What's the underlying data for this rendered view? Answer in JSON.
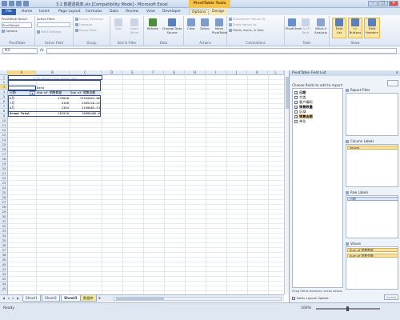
{
  "app": {
    "window_title": "3.1 数据透视表.xls [Compatibility Mode] - Microsoft Excel",
    "context_tab_group": "PivotTable Tools",
    "win_controls": [
      "–",
      "□",
      "✕"
    ]
  },
  "tabs": [
    {
      "label": "File"
    },
    {
      "label": "Home"
    },
    {
      "label": "Insert"
    },
    {
      "label": "Page Layout"
    },
    {
      "label": "Formulas"
    },
    {
      "label": "Data"
    },
    {
      "label": "Review"
    },
    {
      "label": "View"
    },
    {
      "label": "Developer"
    },
    {
      "label": "Options"
    },
    {
      "label": "Design"
    }
  ],
  "ribbon": {
    "pivot_name_label": "PivotTable Name:",
    "pivot_name_value": "PivotTable9",
    "options_label": "Options",
    "active_field_label": "Active Field:",
    "field_settings": "Field Settings",
    "group_selection": "Group Selection",
    "ungroup": "Ungroup",
    "group_field": "Group Field",
    "sort": "Sort",
    "insert_slicer": "Insert Slicer",
    "refresh": "Refresh",
    "change_data_source": "Change Data Source",
    "clear": "Clear",
    "select": "Select",
    "move_pivottable": "Move PivotTable",
    "summarize_values_by": "Summarize Values By",
    "show_values_as": "Show Values As",
    "fields_items_sets": "Fields, Items, & Sets",
    "pivotchart": "PivotChart",
    "olap_tools": "OLAP Tools",
    "what_if": "What-If Analysis",
    "field_list": "Field List",
    "buttons": "+/- Buttons",
    "field_headers": "Field Headers",
    "groups": {
      "pivottable": "PivotTable",
      "active_field": "Active Field",
      "group": "Group",
      "sort_filter": "Sort & Filter",
      "data": "Data",
      "actions": "Actions",
      "calculations": "Calculations",
      "tools": "Tools",
      "show": "Show"
    }
  },
  "formula_bar": {
    "name_box": "A3",
    "fx": "fx",
    "content": ""
  },
  "sheet": {
    "columns": [
      "A",
      "B",
      "C",
      "D",
      "E",
      "F",
      "G",
      "H",
      "I",
      "J",
      "K",
      "L"
    ],
    "rows": [
      "1",
      "2",
      "3",
      "4",
      "5",
      "6",
      "7",
      "8",
      "9",
      "10",
      "11",
      "12",
      "13",
      "14",
      "15",
      "16",
      "17",
      "18",
      "19",
      "20",
      "21",
      "22",
      "23",
      "24",
      "25",
      "26",
      "27",
      "28",
      "29",
      "30",
      "31",
      "32",
      "33",
      "34",
      "35",
      "36",
      "37",
      "38",
      "39",
      "40",
      "41",
      "42",
      "43",
      "44",
      "45"
    ],
    "report_filter_hint": "Drop Report Filter Fields Here",
    "data_label": "Data",
    "row_label_header": "日期",
    "col1_header": "Sum of 销售数量",
    "col2_header": "Sum of 销售金额",
    "pivot_rows": [
      {
        "label": "6月",
        "qty": "175048",
        "amount": "72342053.88"
      },
      {
        "label": "7月",
        "qty": "4168",
        "amount": "2365118.22"
      },
      {
        "label": "8月",
        "qty": "2304",
        "amount": "2190885.53"
      }
    ],
    "grand_total_label": "Grand Total",
    "grand_total_qty": "181518",
    "grand_total_amount": "76898406.6"
  },
  "sheet_tabs": [
    "Sheet1",
    "Sheet2",
    "Sheet3",
    "数据库"
  ],
  "field_list": {
    "title": "PivotTable Field List",
    "choose_label": "Choose fields to add to report:",
    "fields": [
      {
        "name": "日期",
        "checked": true,
        "bold": true
      },
      {
        "name": "大类",
        "checked": false,
        "bold": false
      },
      {
        "name": "客户编码",
        "checked": false,
        "bold": false
      },
      {
        "name": "销售数量",
        "checked": true,
        "bold": true
      },
      {
        "name": "区域",
        "checked": false,
        "bold": false
      },
      {
        "name": "销售金额",
        "checked": true,
        "bold": true
      },
      {
        "name": "单位",
        "checked": false,
        "bold": false
      }
    ],
    "drag_label": "Drag fields between areas below:",
    "report_filter": "Report Filter",
    "column_labels": "Column Labels",
    "column_values_chip": "Values",
    "row_labels": "Row Labels",
    "row_chip": "日期",
    "values_label": "Values",
    "values_chips": [
      "Sum of 销售数量",
      "Sum of 销售金额"
    ],
    "defer_label": "Defer Layout Update",
    "update_button": "Update"
  },
  "status": {
    "ready": "Ready",
    "zoom": "100%"
  }
}
